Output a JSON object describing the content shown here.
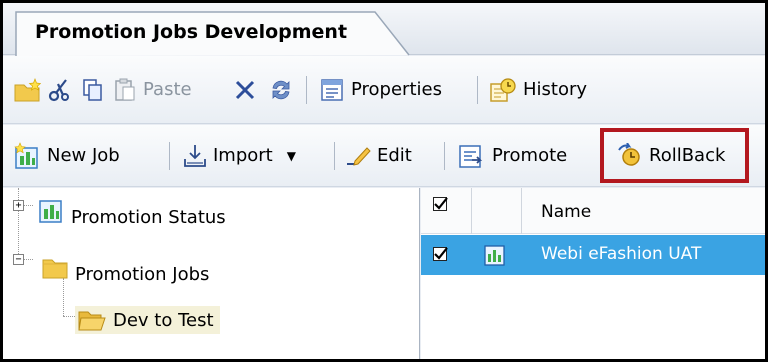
{
  "tab": {
    "title": "Promotion Jobs Development"
  },
  "toolbar1": {
    "paste": "Paste",
    "properties": "Properties",
    "history": "History"
  },
  "toolbar2": {
    "new_job": "New Job",
    "import": "Import",
    "edit": "Edit",
    "promote": "Promote",
    "rollback": "RollBack"
  },
  "tree": {
    "items": [
      {
        "label": "Promotion Status",
        "icon": "promotion-status-icon",
        "expanded": false
      },
      {
        "label": "Promotion Jobs",
        "icon": "folder-icon",
        "expanded": true
      },
      {
        "label": "Dev to Test",
        "icon": "open-folder-icon",
        "selected": true
      }
    ]
  },
  "grid": {
    "columns": [
      "Name"
    ],
    "rows": [
      {
        "name": "Webi eFashion UAT",
        "checked": true,
        "selected": true
      }
    ]
  },
  "colors": {
    "highlight_box": "#b3181f",
    "selection": "#3aa3e3"
  }
}
